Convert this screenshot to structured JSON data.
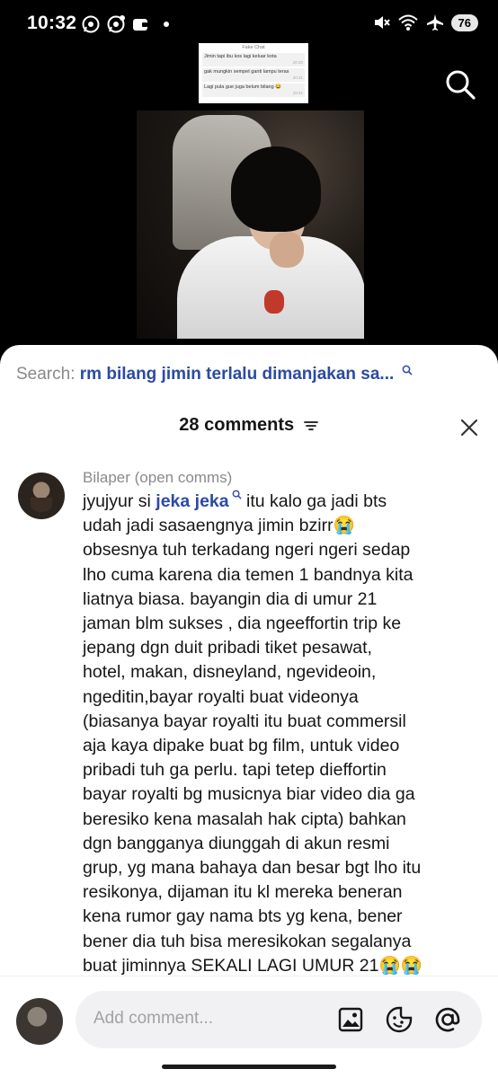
{
  "status_bar": {
    "time": "10:32",
    "battery": "76"
  },
  "video": {
    "chat_overlay": {
      "header": "Fake Chat",
      "messages": [
        {
          "text": "Jimin tapi ibu kos lagi keluar kota",
          "time": "20:20"
        },
        {
          "text": "gak mungkin sempet ganti lampu teras",
          "time": "20:21"
        },
        {
          "text": "Lagi pula gue juga belum bilang 😂",
          "time": "20:21"
        }
      ]
    }
  },
  "sheet": {
    "search_label": "Search:",
    "search_query": "rm bilang jimin terlalu dimanjakan sa...",
    "comments_count": "28 comments"
  },
  "comment": {
    "author": "Bilaper (open comms)",
    "text_before": "jyujyur si ",
    "link": "jeka jeka",
    "text_after": " itu kalo ga jadi bts\nudah jadi sasaengnya jimin bzirr😭\nobsesnya tuh terkadang ngeri ngeri sedap\nlho cuma karena dia temen 1 bandnya kita\nliatnya biasa. bayangin dia di umur 21\njaman blm sukses , dia ngeeffortin trip ke\njepang dgn duit pribadi tiket pesawat,\nhotel, makan, disneyland, ngevideoin,\nngeditin,bayar royalti buat videonya\n(biasanya bayar royalti itu buat commersil\naja kaya dipake buat bg film, untuk video\npribadi tuh ga perlu. tapi tetep dieffortin\nbayar royalti bg musicnya biar video dia ga\nberesiko kena masalah hak cipta) bahkan\ndgn bangganya diunggah di akun resmi\ngrup, yg mana bahaya dan besar bgt lho itu\nresikonya, dijaman itu kl mereka beneran\nkena rumor gay nama bts yg kena, bener\nbener dia tuh bisa meresikokan segalanya\nbuat jiminnya SEKALI LAGI UMUR 21😭😭"
  },
  "comment_input": {
    "placeholder": "Add comment..."
  }
}
